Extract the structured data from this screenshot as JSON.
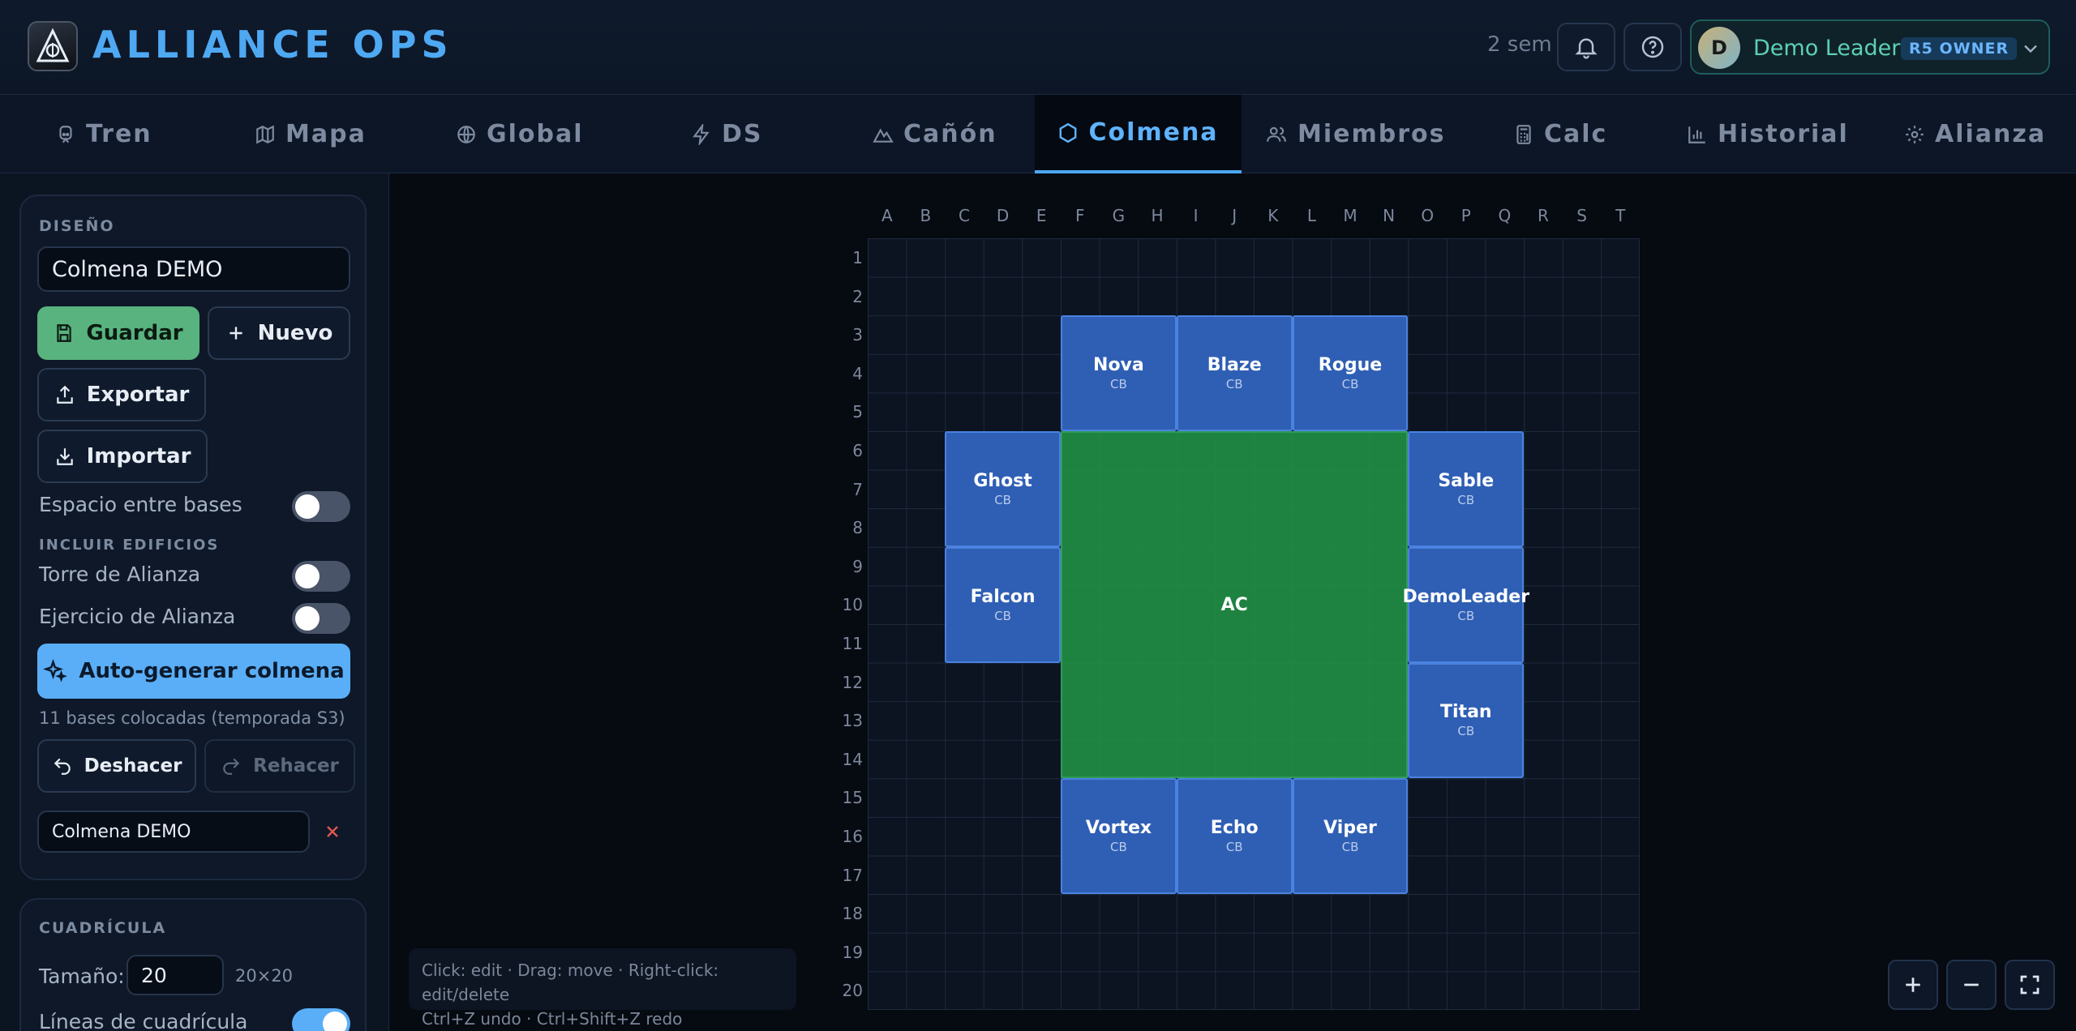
{
  "header": {
    "app_title": "ALLIANCE OPS",
    "week": "2 sem",
    "user": {
      "initial": "D",
      "name": "Demo Leader",
      "role": "R5 OWNER"
    }
  },
  "tabs": [
    {
      "label": "Tren",
      "icon": "train-icon"
    },
    {
      "label": "Mapa",
      "icon": "map-icon"
    },
    {
      "label": "Global",
      "icon": "globe-icon"
    },
    {
      "label": "DS",
      "icon": "lightning-icon"
    },
    {
      "label": "Cañón",
      "icon": "mountain-icon"
    },
    {
      "label": "Colmena",
      "icon": "hexagon-icon",
      "active": true
    },
    {
      "label": "Miembros",
      "icon": "users-icon"
    },
    {
      "label": "Calc",
      "icon": "calculator-icon"
    },
    {
      "label": "Historial",
      "icon": "bar-chart-icon"
    },
    {
      "label": "Alianza",
      "icon": "gear-icon"
    }
  ],
  "sidebar": {
    "design_label": "DISEÑO",
    "design_name": "Colmena DEMO",
    "save": "Guardar",
    "new": "Nuevo",
    "export": "Exportar",
    "import": "Importar",
    "spacing_label": "Espacio entre bases",
    "spacing_on": false,
    "include_label": "INCLUIR EDIFICIOS",
    "tower_label": "Torre de Alianza",
    "tower_on": false,
    "exercise_label": "Ejercicio de Alianza",
    "exercise_on": false,
    "autogen": "Auto-generar colmena",
    "placed_note": "11 bases colocadas (temporada S3)",
    "undo": "Deshacer",
    "redo": "Rehacer",
    "saved_design": "Colmena DEMO",
    "grid_label": "CUADRÍCULA",
    "size_label": "Tamaño:",
    "size_value": "20",
    "size_dims": "20×20",
    "gridlines_label": "Líneas de cuadrícula",
    "gridlines_on": true
  },
  "grid": {
    "columns": [
      "A",
      "B",
      "C",
      "D",
      "E",
      "F",
      "G",
      "H",
      "I",
      "J",
      "K",
      "L",
      "M",
      "N",
      "O",
      "P",
      "Q",
      "R",
      "S",
      "T"
    ],
    "rows": [
      "1",
      "2",
      "3",
      "4",
      "5",
      "6",
      "7",
      "8",
      "9",
      "10",
      "11",
      "12",
      "13",
      "14",
      "15",
      "16",
      "17",
      "18",
      "19",
      "20"
    ],
    "center": {
      "label": "AC",
      "col": 6,
      "row": 6,
      "w": 9,
      "h": 9
    },
    "bases": [
      {
        "name": "Nova",
        "type": "CB",
        "col": 6,
        "row": 3
      },
      {
        "name": "Blaze",
        "type": "CB",
        "col": 9,
        "row": 3
      },
      {
        "name": "Rogue",
        "type": "CB",
        "col": 12,
        "row": 3
      },
      {
        "name": "Ghost",
        "type": "CB",
        "col": 3,
        "row": 6
      },
      {
        "name": "Sable",
        "type": "CB",
        "col": 15,
        "row": 6
      },
      {
        "name": "Falcon",
        "type": "CB",
        "col": 3,
        "row": 9
      },
      {
        "name": "DemoLeader",
        "type": "CB",
        "col": 15,
        "row": 9
      },
      {
        "name": "Titan",
        "type": "CB",
        "col": 15,
        "row": 12
      },
      {
        "name": "Vortex",
        "type": "CB",
        "col": 6,
        "row": 15
      },
      {
        "name": "Echo",
        "type": "CB",
        "col": 9,
        "row": 15
      },
      {
        "name": "Viper",
        "type": "CB",
        "col": 12,
        "row": 15
      }
    ]
  },
  "hint": {
    "line1": "Click: edit · Drag: move · Right-click: edit/delete",
    "line2": "Ctrl+Z undo · Ctrl+Shift+Z redo"
  },
  "zoom": {
    "in": "+",
    "out": "−",
    "fit": "fullscreen-icon"
  },
  "colors": {
    "accent": "#4ea8f2",
    "base": "#2f5fb4",
    "center": "#228f46",
    "save": "#59b37e"
  }
}
